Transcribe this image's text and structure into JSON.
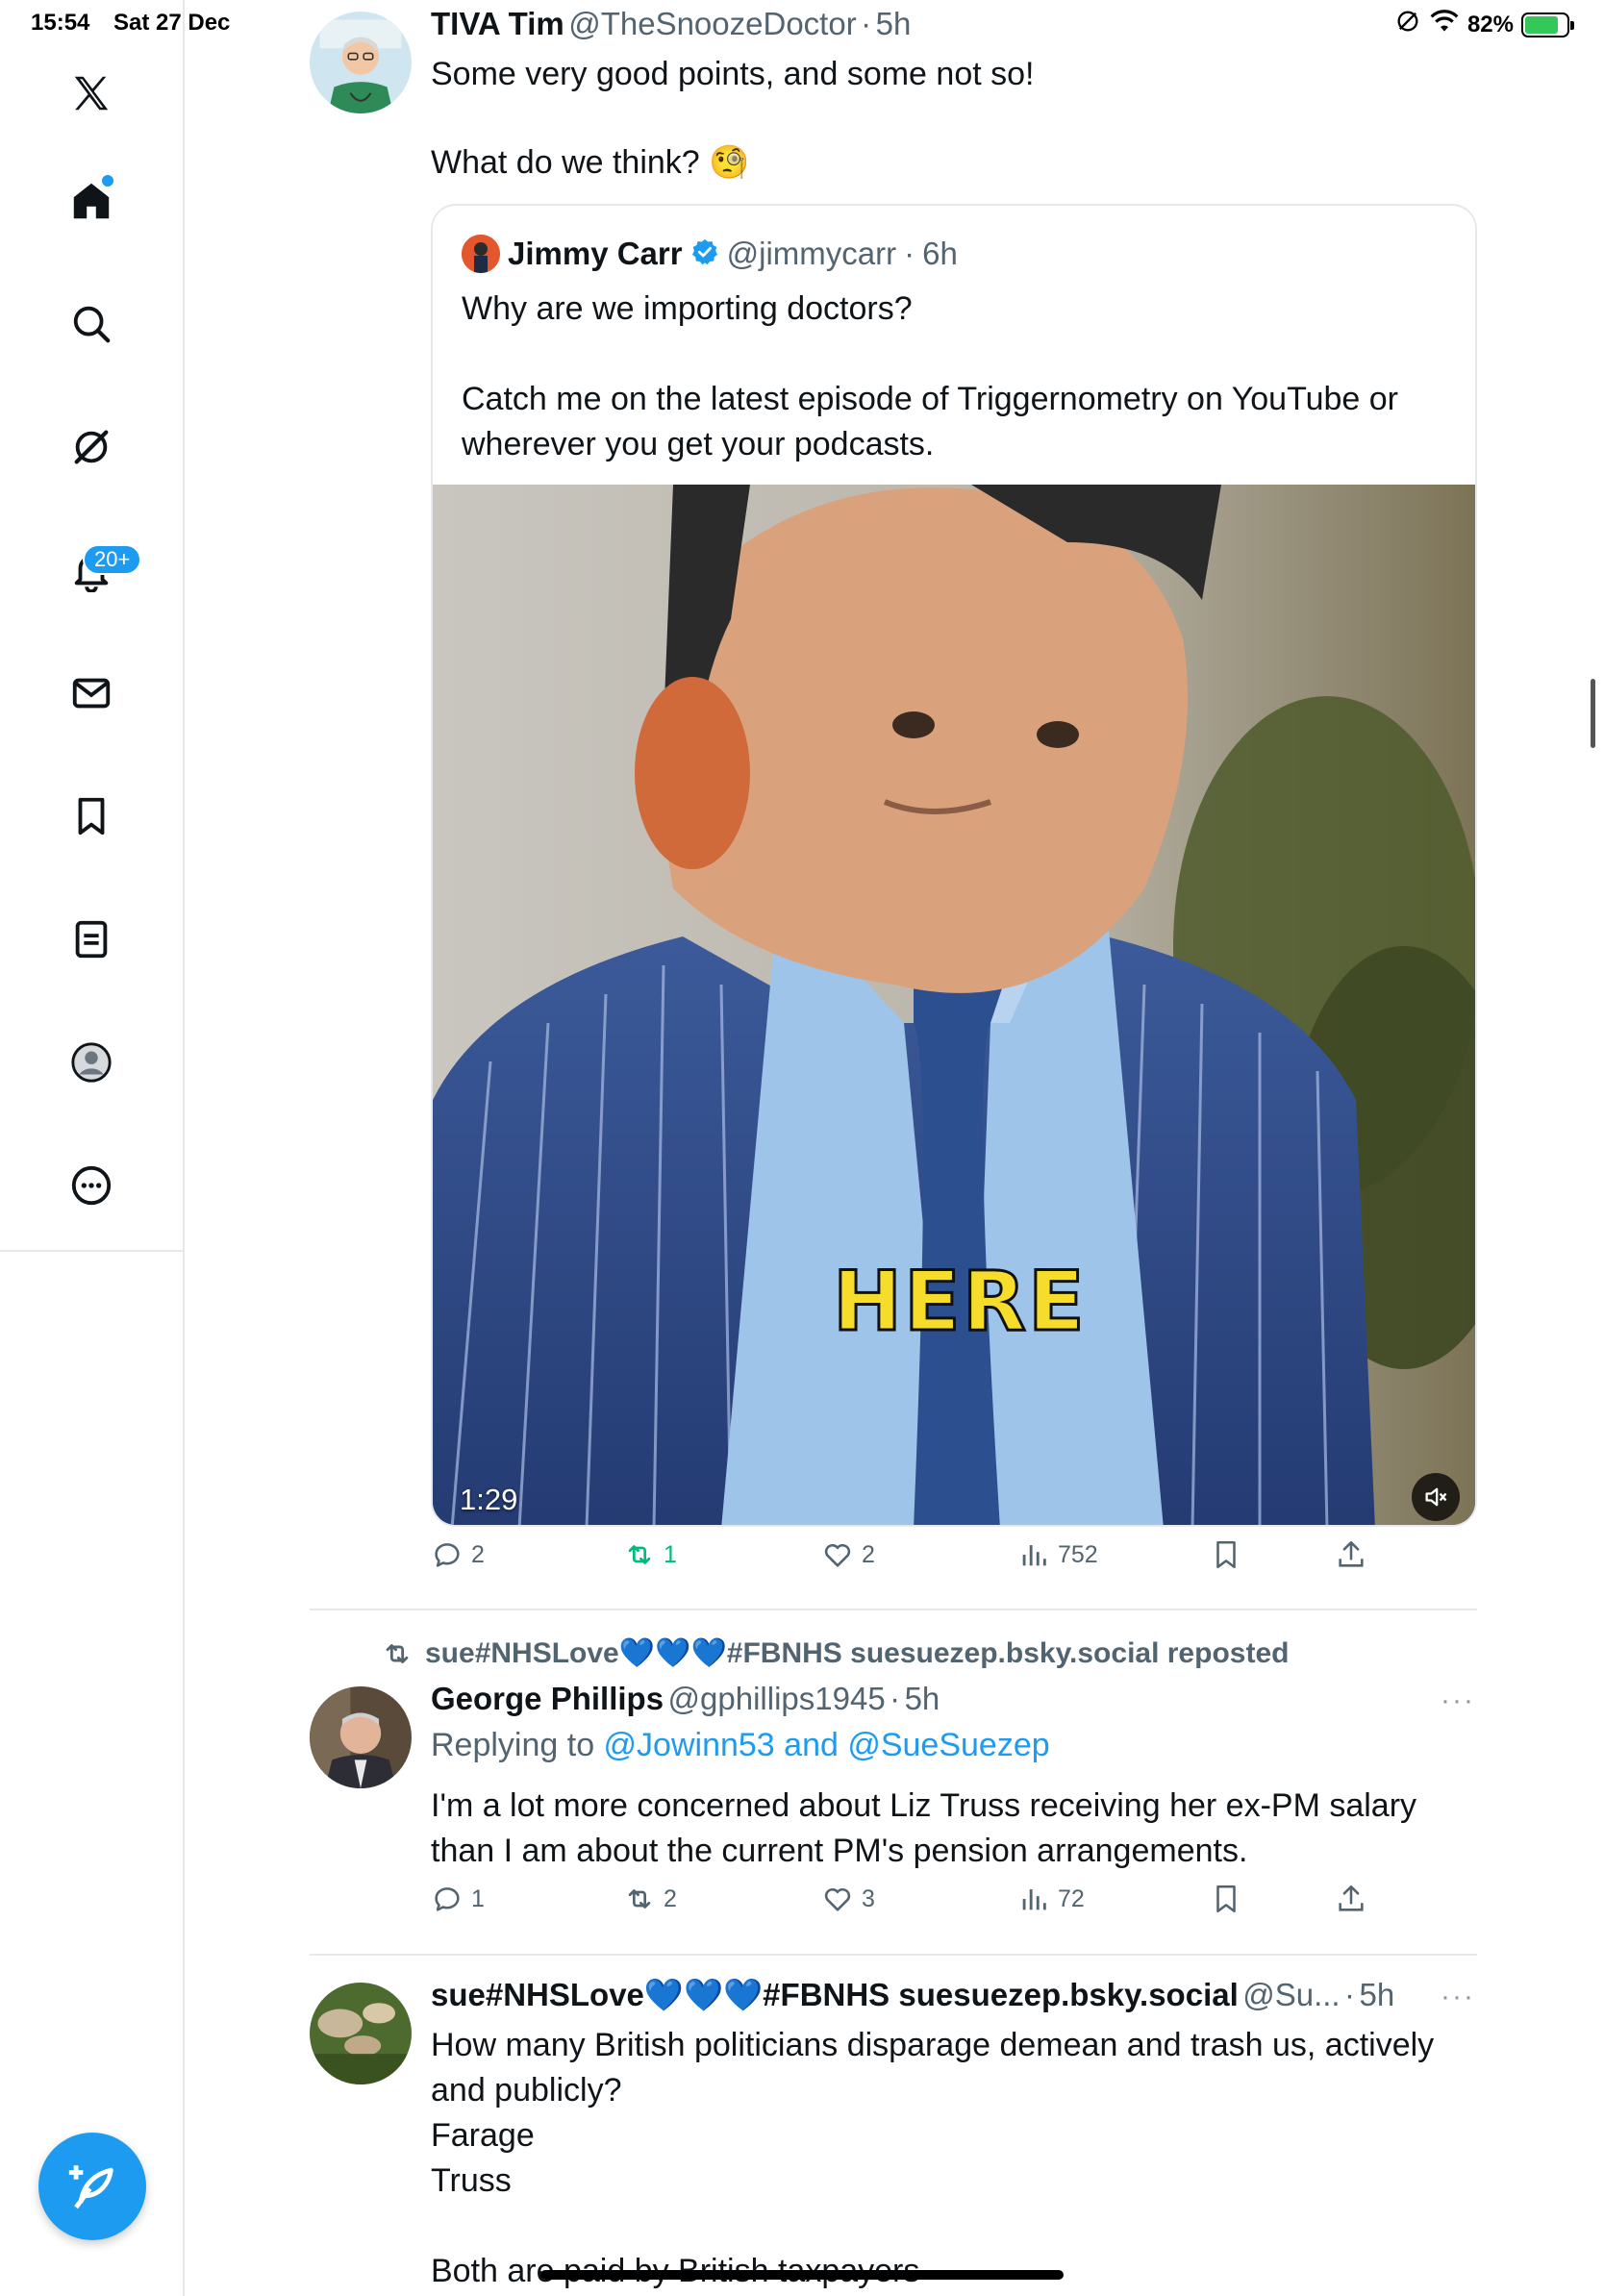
{
  "status": {
    "time": "15:54",
    "date": "Sat 27 Dec",
    "battery": "82%",
    "battery_level": 0.82
  },
  "sidebar": {
    "notifications_badge": "20+",
    "items": [
      "x-logo",
      "home",
      "search",
      "grok",
      "notifications",
      "messages",
      "bookmarks",
      "lists",
      "profile",
      "more"
    ]
  },
  "tweet1": {
    "name": "TIVA Tim",
    "handle": "@TheSnoozeDoctor",
    "sep": "·",
    "time": "5h",
    "text_line1": "Some very good points, and some not so!",
    "text_line2": "What do we think? 🧐",
    "quote": {
      "name": "Jimmy Carr",
      "handle": "@jimmycarr",
      "sep": "·",
      "time": "6h",
      "line1": "Why are we importing doctors?",
      "line2": "Catch me on the latest episode of Triggernometry on YouTube or",
      "line3": "wherever you get your podcasts.",
      "video_caption": "HERE",
      "video_duration": "1:29"
    },
    "actions": {
      "replies": "2",
      "reposts": "1",
      "likes": "2",
      "views": "752"
    }
  },
  "tweet2": {
    "reposted_by": "sue#NHSLove💙💙💙#FBNHS suesuezep.bsky.social reposted",
    "name": "George Phillips",
    "handle": "@gphillips1945",
    "sep": "·",
    "time": "5h",
    "replying_prefix": "Replying to ",
    "replying_to": "@Jowinn53 and @SueSuezep",
    "line1": "I'm a lot more concerned about Liz Truss receiving her ex-PM salary",
    "line2": "than I am about the current PM's pension arrangements.",
    "more": "···",
    "actions": {
      "replies": "1",
      "reposts": "2",
      "likes": "3",
      "views": "72"
    }
  },
  "tweet3": {
    "name": "sue#NHSLove💙💙💙#FBNHS suesuezep.bsky.social",
    "handle": "@Su...",
    "sep": "·",
    "time": "5h",
    "more": "···",
    "line1": "How many British politicians disparage demean and trash us, actively",
    "line2": "and publicly?",
    "line3": "Farage",
    "line4": "Truss",
    "line5": "Both are paid by British taxpayers"
  },
  "colors": {
    "accent": "#1d9bf0",
    "repost_green": "#00ba7c",
    "muted": "#536471"
  }
}
